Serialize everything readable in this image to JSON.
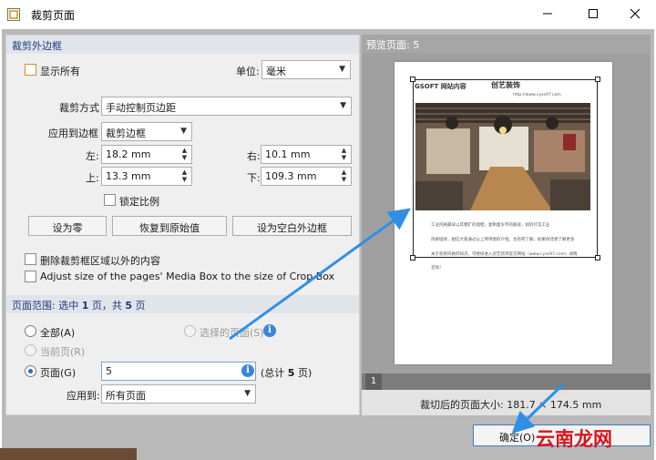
{
  "window": {
    "title": "裁剪页面"
  },
  "crop_margins": {
    "header": "裁剪外边框",
    "show_all_label": "显示所有",
    "unit_label": "单位:",
    "unit_value": "毫米",
    "crop_method_label": "裁剪方式",
    "crop_method_value": "手动控制页边距",
    "apply_to_box_label": "应用到边框",
    "apply_to_box_value": "裁剪边框",
    "left_label": "左:",
    "left_value": "18.2 mm",
    "right_label": "右:",
    "right_value": "10.1 mm",
    "top_label": "上:",
    "top_value": "13.3 mm",
    "bottom_label": "下:",
    "bottom_value": "109.3 mm",
    "lock_ratio_label": "锁定比例",
    "set_zero_button": "设为零",
    "restore_button": "恢复到原始值",
    "set_blank_button": "设为空白外边框",
    "delete_outside_label": "删除裁剪框区域以外的内容",
    "adjust_media_box_label": "Adjust size of the pages' Media Box to the size of Crop Box"
  },
  "page_range": {
    "header_prefix": "页面范围: 选中",
    "selected_count": "1",
    "header_middle": "页，共",
    "total_count": "5",
    "header_suffix": "页",
    "all_label": "全部(A)",
    "selected_pages_label": "选择的页面(S)",
    "current_page_label": "当前页(R)",
    "pages_label": "页面(G)",
    "pages_value": "5",
    "total_note_prefix": "(总计",
    "total_note_count": "5",
    "total_note_suffix": "页)",
    "apply_to_label": "应用到:",
    "apply_to_value": "所有页面"
  },
  "preview": {
    "header": "预览页面: 5",
    "page_number": "1",
    "cropped_size": "裁切后的页面大小: 181.7 × 174.5 mm",
    "doc_logo": "创艺装饰",
    "doc_logo_small": "GSOFT 网站内容",
    "doc_url": "http://www.cyxs97.com",
    "doc_lines": [
      "工业风格最早以其粗犷的墙壁，复制着岁月的痕迹，如何打造工业",
      "风格墙体，相信大家通过以上简单图的介绍，也有所了解，如果你还想了解更多",
      "关于装修风格的知识，可继续进入创艺装饰官方网站（www.cyxs97.com）详情",
      "咨询！"
    ]
  },
  "footer": {
    "ok_button": "确定(O)",
    "watermark": "云南龙网"
  },
  "colors": {
    "accent": "#2b66c8",
    "arrow": "#2f8fe6",
    "header_text": "#1c3a7a",
    "watermark": "#d9131b"
  }
}
